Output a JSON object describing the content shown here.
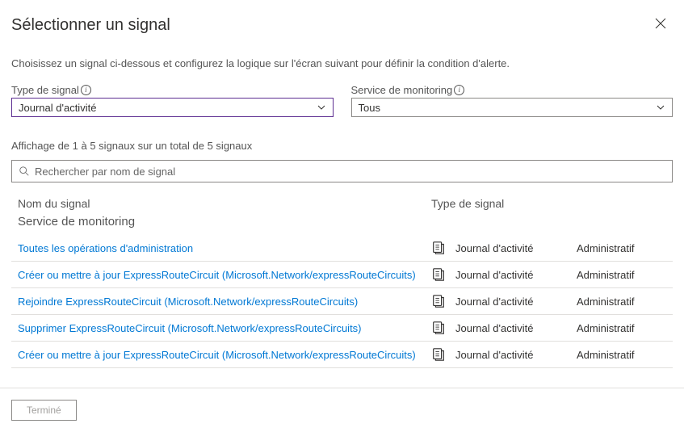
{
  "header": {
    "title": "Sélectionner un signal"
  },
  "subtitle": "Choisissez un signal ci-dessous et configurez la logique sur l'écran suivant pour définir la condition d'alerte.",
  "filters": {
    "signal_type": {
      "label": "Type de signal",
      "value": "Journal d'activité"
    },
    "monitor_service": {
      "label": "Service de monitoring",
      "value": "Tous"
    }
  },
  "count_text": "Affichage de 1 à 5 signaux sur un total de 5 signaux",
  "search": {
    "placeholder": "Rechercher par nom de signal"
  },
  "columns": {
    "name": "Nom du signal",
    "type": "Type de signal",
    "service": "Service de monitoring"
  },
  "rows": [
    {
      "name": "Toutes les opérations d'administration",
      "type": "Journal d'activité",
      "service": "Administratif"
    },
    {
      "name": "Créer ou mettre à jour ExpressRouteCircuit (Microsoft.Network/expressRouteCircuits)",
      "type": "Journal d'activité",
      "service": "Administratif"
    },
    {
      "name": "Rejoindre ExpressRouteCircuit (Microsoft.Network/expressRouteCircuits)",
      "type": "Journal d'activité",
      "service": "Administratif"
    },
    {
      "name": "Supprimer ExpressRouteCircuit (Microsoft.Network/expressRouteCircuits)",
      "type": "Journal d'activité",
      "service": "Administratif"
    },
    {
      "name": "Créer ou mettre à jour ExpressRouteCircuit (Microsoft.Network/expressRouteCircuits)",
      "type": "Journal d'activité",
      "service": "Administratif"
    }
  ],
  "footer": {
    "done": "Terminé"
  }
}
